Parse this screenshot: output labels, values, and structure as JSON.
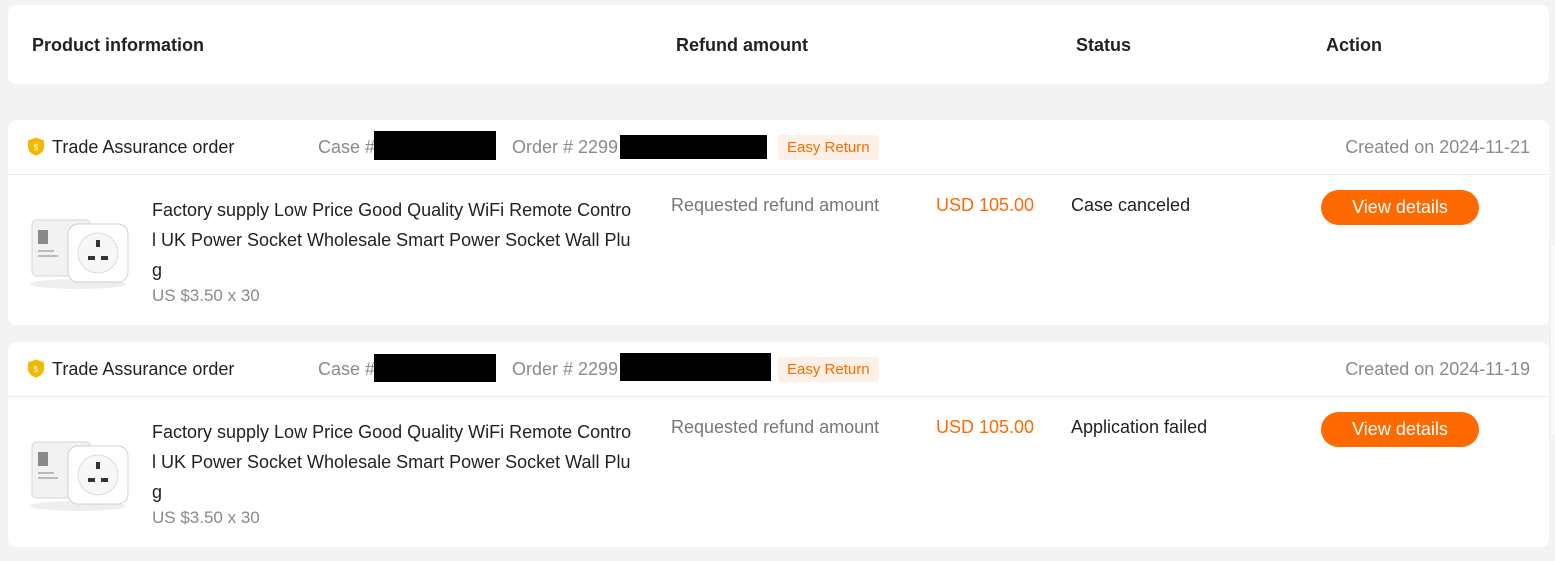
{
  "header": {
    "product_info": "Product information",
    "refund_amount": "Refund amount",
    "status": "Status",
    "action": "Action"
  },
  "orders": [
    {
      "order_type": "Trade Assurance order",
      "case_label": "Case #",
      "order_label": "Order # 2299",
      "badge": "Easy Return",
      "created": "Created on 2024-11-21",
      "product_title": "Factory supply Low Price Good Quality WiFi Remote Control UK Power Socket Wholesale Smart Power Socket Wall Plug",
      "price": "US $3.50 x 30",
      "refund_label": "Requested refund amount",
      "refund_amount": "USD 105.00",
      "status": "Case canceled",
      "action": "View details"
    },
    {
      "order_type": "Trade Assurance order",
      "case_label": "Case #",
      "order_label": "Order # 2299",
      "badge": "Easy Return",
      "created": "Created on 2024-11-19",
      "product_title": "Factory supply Low Price Good Quality WiFi Remote Control UK Power Socket Wholesale Smart Power Socket Wall Plug",
      "price": "US $3.50 x 30",
      "refund_label": "Requested refund amount",
      "refund_amount": "USD 105.00",
      "status": "Application failed",
      "action": "View details"
    }
  ],
  "icons": {
    "trade_assurance": "shield-icon"
  },
  "colors": {
    "accent": "#ff6a00",
    "badge_bg": "#fdf0e6",
    "shield": "#f5b800"
  }
}
